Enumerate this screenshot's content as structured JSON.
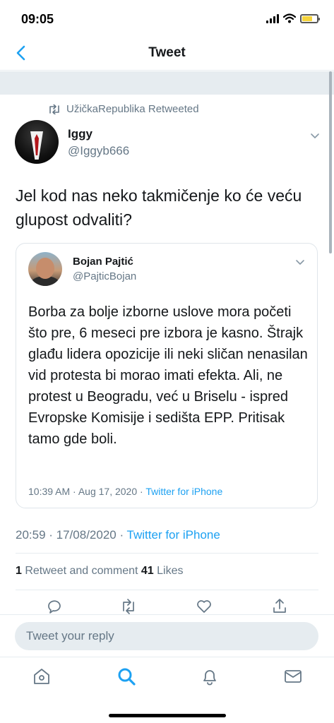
{
  "status_bar": {
    "time": "09:05",
    "battery_level": 0.7,
    "battery_color": "#f5d33a"
  },
  "header": {
    "title": "Tweet",
    "back_icon": "chevron-left-icon"
  },
  "retweet_context": {
    "text": "UžičkaRepublika Retweeted",
    "icon": "retweet-icon"
  },
  "tweet": {
    "author_name": "Iggy",
    "author_handle": "@Iggyb666",
    "text": "Jel kod nas neko takmičenje ko će veću glupost odvaliti?",
    "time": "20:59 · 17/08/2020 · ",
    "source": "Twitter for iPhone"
  },
  "quoted_tweet": {
    "author_name": "Bojan Pajtić",
    "author_handle": "@PajticBojan",
    "text": "Borba za bolje izborne uslove mora početi što pre, 6 meseci pre izbora je kasno. Štrajk glađu lidera opozicije ili neki sličan nenasilan vid protesta bi morao imati efekta. Ali, ne protest u Beogradu, već u Briselu - ispred Evropske Komisije i sedišta EPP. Pritisak tamo gde boli.",
    "time": "10:39 AM · Aug 17, 2020 · ",
    "source": "Twitter for iPhone"
  },
  "stats": {
    "retweets_count": "1",
    "retweets_label": " Retweet and comment ",
    "likes_count": "41",
    "likes_label": " Likes"
  },
  "actions": [
    "reply-icon",
    "retweet-icon",
    "like-icon",
    "share-icon"
  ],
  "reply": {
    "placeholder": "Tweet your reply"
  },
  "tab_bar": [
    "home-icon",
    "search-icon",
    "notifications-icon",
    "messages-icon"
  ],
  "colors": {
    "accent": "#1da1f2",
    "muted_text": "#657786",
    "divider": "#e6ecf0"
  }
}
